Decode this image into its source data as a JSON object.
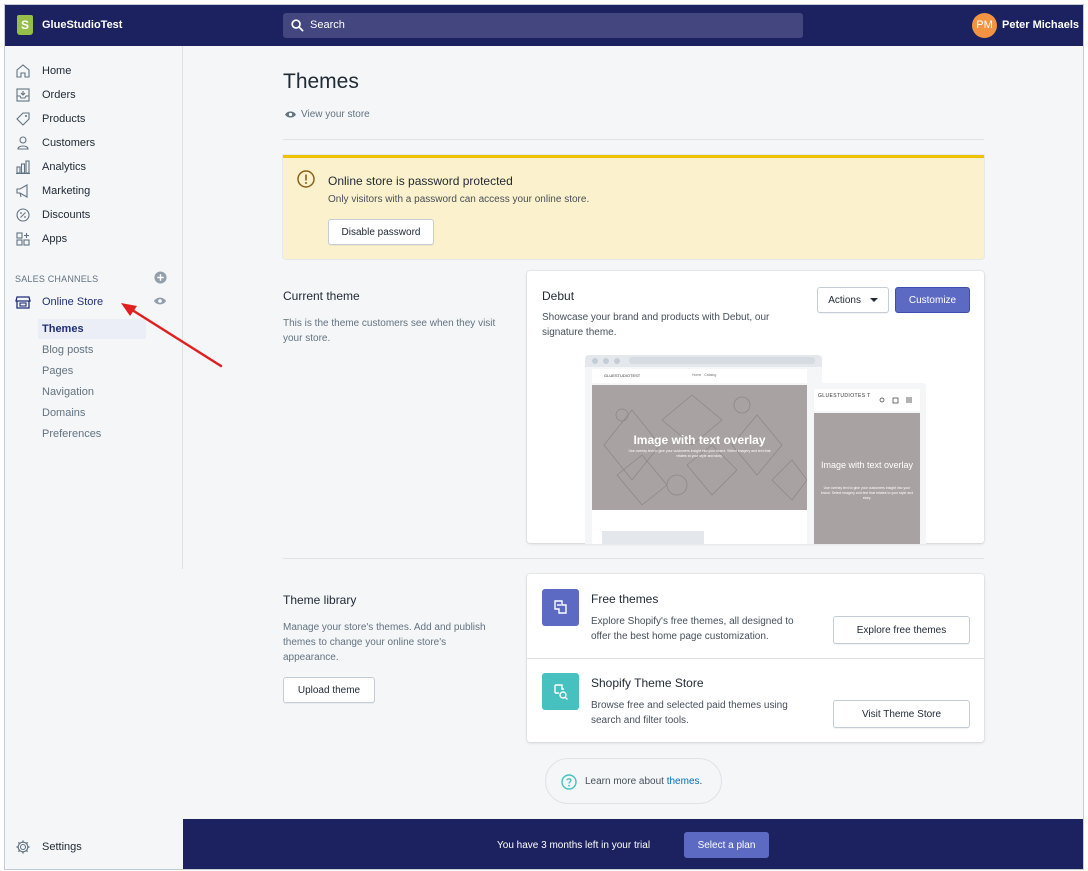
{
  "topbar": {
    "store_name": "GlueStudioTest",
    "search_placeholder": "Search",
    "user_initials": "PM",
    "user_name": "Peter Michaels"
  },
  "sidebar": {
    "items": [
      {
        "label": "Home",
        "icon": "home-icon"
      },
      {
        "label": "Orders",
        "icon": "orders-icon"
      },
      {
        "label": "Products",
        "icon": "tag-icon"
      },
      {
        "label": "Customers",
        "icon": "person-icon"
      },
      {
        "label": "Analytics",
        "icon": "bar-chart-icon"
      },
      {
        "label": "Marketing",
        "icon": "megaphone-icon"
      },
      {
        "label": "Discounts",
        "icon": "discount-icon"
      },
      {
        "label": "Apps",
        "icon": "apps-icon"
      }
    ],
    "sales_channels_heading": "SALES CHANNELS",
    "online_store_label": "Online Store",
    "sub_items": [
      "Themes",
      "Blog posts",
      "Pages",
      "Navigation",
      "Domains",
      "Preferences"
    ],
    "active_sub_item": "Themes",
    "settings_label": "Settings"
  },
  "page": {
    "title": "Themes",
    "view_store": "View your store"
  },
  "banner": {
    "title": "Online store is password protected",
    "text": "Only visitors with a password can access your online store.",
    "button": "Disable password"
  },
  "current_theme": {
    "heading": "Current theme",
    "description": "This is the theme customers see when they visit your store.",
    "theme_name": "Debut",
    "theme_description": "Showcase your brand and products with Debut, our signature theme.",
    "actions_button": "Actions",
    "customize_button": "Customize",
    "preview": {
      "desktop_store": "GLUESTUDIOTEST",
      "desktop_nav": "Home   Catalog",
      "desktop_hero_title": "Image with text overlay",
      "desktop_hero_text": "Use overlay text to give your customers insight into your brand. Select imagery and text that relates to your style and story.",
      "mobile_store": "GLUESTUDIOTES T",
      "mobile_hero_title": "Image with text overlay",
      "mobile_hero_text": "Use overlay text to give your customers insight into your brand. Select imagery and text that relates to your style and story."
    }
  },
  "theme_library": {
    "heading": "Theme library",
    "description": "Manage your store's themes. Add and publish themes to change your online store's appearance.",
    "upload_button": "Upload theme",
    "free_themes": {
      "title": "Free themes",
      "text": "Explore Shopify's free themes, all designed to offer the best home page customization.",
      "button": "Explore free themes"
    },
    "theme_store": {
      "title": "Shopify Theme Store",
      "text": "Browse free and selected paid themes using search and filter tools.",
      "button": "Visit Theme Store"
    }
  },
  "learn_more": {
    "prefix": "Learn more about ",
    "link": "themes",
    "suffix": "."
  },
  "bottom_bar": {
    "trial_text": "You have 3 months left in your trial",
    "select_plan": "Select a plan"
  },
  "colors": {
    "topbar": "#1c2260",
    "primary": "#5c6ac4",
    "banner_bg": "#fcf1cd",
    "banner_accent": "#eec200",
    "annotation_arrow": "#e02020",
    "free_themes_icon": "#5c6ac4",
    "theme_store_icon": "#47c1bf"
  }
}
